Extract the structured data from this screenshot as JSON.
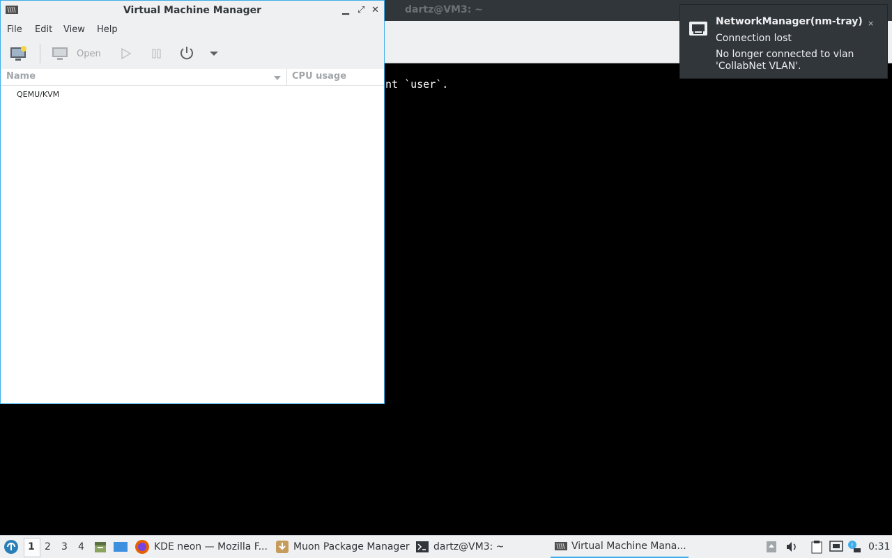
{
  "terminal": {
    "title": "dartz@VM3: ~",
    "visible_text": "nt `user`."
  },
  "vmm": {
    "title": "Virtual Machine Manager",
    "menu": [
      "File",
      "Edit",
      "View",
      "Help"
    ],
    "toolbar": {
      "new_vm_icon": "new-vm-icon",
      "open_label": "Open",
      "run_icon": "play-icon",
      "pause_icon": "pause-icon",
      "power_icon": "power-icon",
      "dropdown_icon": "chevron-down-icon"
    },
    "columns": {
      "name": "Name",
      "cpu": "CPU usage"
    },
    "connections": [
      "QEMU/KVM"
    ]
  },
  "notification": {
    "app": "NetworkManager(nm-tray)",
    "summary": "Connection lost",
    "body": "No longer connected to vlan 'CollabNet VLAN'.",
    "close": "×"
  },
  "taskbar": {
    "desktops": [
      "1",
      "2",
      "3",
      "4"
    ],
    "active_desktop": "1",
    "tasks": [
      {
        "label": "KDE neon — Mozilla F..."
      },
      {
        "label": "Muon Package Manager"
      },
      {
        "label": "dartz@VM3: ~"
      },
      {
        "label": "Virtual Machine Mana..."
      }
    ],
    "clock": "0:31"
  },
  "colors": {
    "accent": "#3daee9",
    "panel": "#eff0f1",
    "notification_bg": "#31363b",
    "text": "#31363b"
  }
}
